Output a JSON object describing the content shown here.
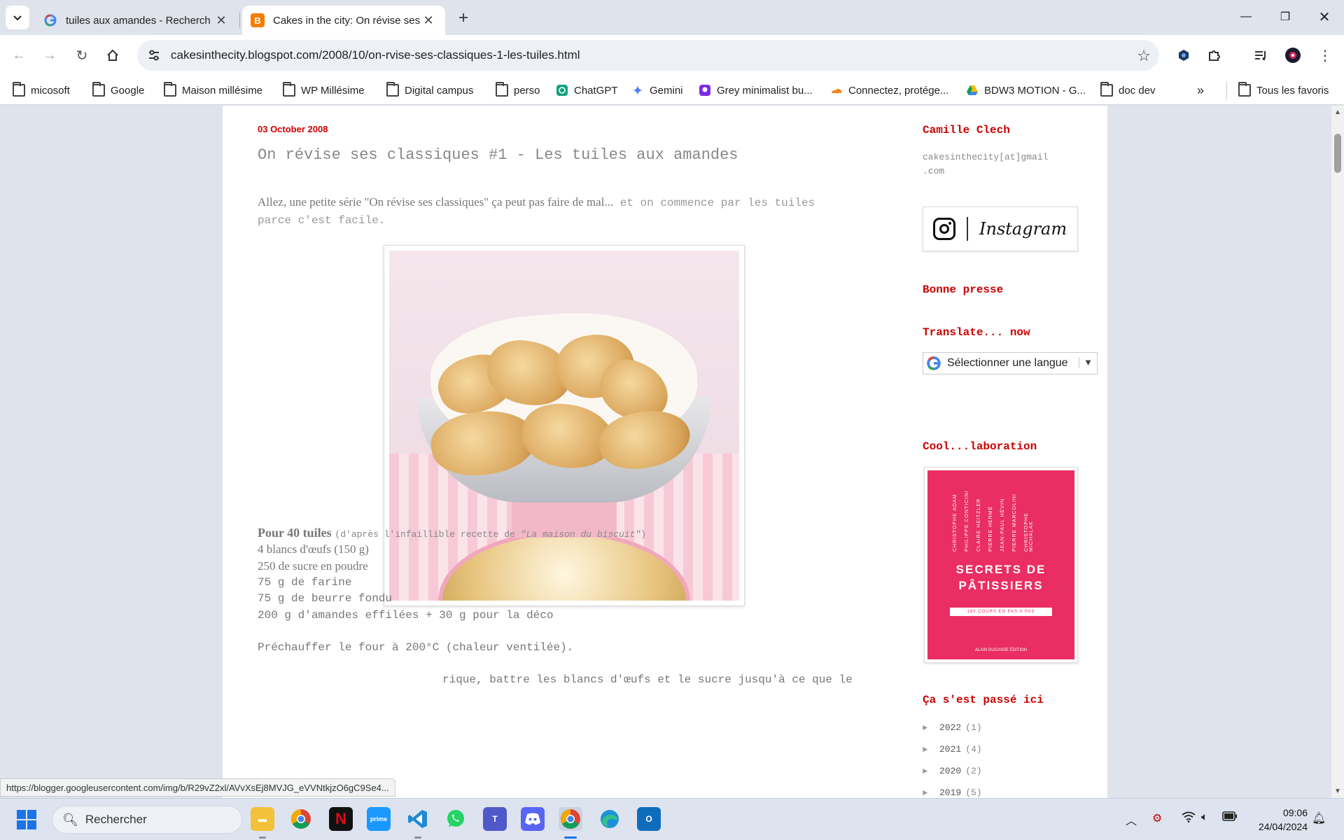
{
  "browser": {
    "tabs": [
      {
        "title": "tuiles aux amandes - Recherch",
        "favicon": "google-icon",
        "active": false
      },
      {
        "title": "Cakes in the city: On révise ses",
        "favicon": "blogger-icon",
        "active": true
      }
    ],
    "url": "cakesinthecity.blogspot.com/2008/10/on-rvise-ses-classiques-1-les-tuiles.html",
    "bookmarks": [
      {
        "label": "micosoft",
        "icon": "folder-icon"
      },
      {
        "label": "Google",
        "icon": "folder-icon"
      },
      {
        "label": "Maison millésime",
        "icon": "folder-icon"
      },
      {
        "label": "WP Millésime",
        "icon": "folder-icon"
      },
      {
        "label": "Digital campus",
        "icon": "folder-icon"
      },
      {
        "label": "perso",
        "icon": "folder-icon"
      },
      {
        "label": "ChatGPT",
        "icon": "chatgpt-icon"
      },
      {
        "label": "Gemini",
        "icon": "gemini-icon"
      },
      {
        "label": "Grey minimalist bu...",
        "icon": "canva-icon"
      },
      {
        "label": "Connectez, protége...",
        "icon": "cloudflare-icon"
      },
      {
        "label": "BDW3 MOTION - G...",
        "icon": "drive-icon"
      },
      {
        "label": "doc dev",
        "icon": "folder-icon"
      }
    ],
    "all_bookmarks": "Tous les favoris",
    "status_url": "https://blogger.googleusercontent.com/img/b/R29vZ2xl/AVvXsEj8MVJG_eVVNtkjzO6gC9Se4..."
  },
  "post": {
    "date": "03 October 2008",
    "title": "On révise ses classiques #1 - Les tuiles aux amandes",
    "intro_serif": "Allez, une petite série \"On révise ses classiques\" ça peut pas faire de mal...",
    "intro_mono_1": " et on commence par les tuiles",
    "intro_mono_2": "parce c'est facile.",
    "recipe_heading": "Pour 40 tuiles",
    "recipe_source_prefix": "(d'après l'infaillible recette de ",
    "recipe_source_book": "\"La maison du biscuit\"",
    "recipe_source_suffix": ")",
    "ingredients": [
      "4 blancs d'œufs (150 g)",
      "250 de sucre en poudre",
      "75 g de farine",
      "75 g de beurre fondu",
      "200 g d'amandes effilées + 30 g pour la déco"
    ],
    "step1": "Préchauffer le four à 200°C (chaleur ventilée).",
    "step2_visible": "rique, battre les blancs d'œufs et le sucre jusqu'à ce que le"
  },
  "sidebar": {
    "author": "Camille Clech",
    "email_line1": "cakesinthecity[at]gmail",
    "email_line2": ".com",
    "instagram_label": "Instagram",
    "press_title": "Bonne presse",
    "translate_title": "Translate... now",
    "translate_select": "Sélectionner une langue",
    "collab_title": "Cool...laboration",
    "book": {
      "chefs": [
        "CHRISTOPHE ADAM",
        "PHILIPPE CONTICINI",
        "CLAIRE HEITZLER",
        "PIERRE HERMÉ",
        "JEAN-PAUL HÉVIN",
        "PIERRE MARCOLINI",
        "CHRISTOPHE MICHALAK"
      ],
      "title1": "SECRETS DE",
      "title2": "PÂTISSIERS",
      "band": "180 COURS EN PAS A PAS",
      "publisher": "ALAIN DUCASSE ÉDITION"
    },
    "archive_title": "Ça s'est passé ici",
    "archive": [
      {
        "year": "2022",
        "count": "(1)"
      },
      {
        "year": "2021",
        "count": "(4)"
      },
      {
        "year": "2020",
        "count": "(2)"
      },
      {
        "year": "2019",
        "count": "(5)"
      }
    ]
  },
  "taskbar": {
    "search": "Rechercher",
    "time": "09:06",
    "date": "24/04/2024",
    "apps": [
      "file-explorer-icon",
      "chrome-icon",
      "netflix-icon",
      "prime-video-icon",
      "vscode-icon",
      "whatsapp-icon",
      "teams-icon",
      "discord-icon",
      "chrome-active-icon",
      "edge-icon",
      "outlook-icon"
    ]
  },
  "colors": {
    "accent_red": "#cc0000",
    "book_pink": "#ea2d62",
    "chrome_frame": "#dfe3eb"
  }
}
